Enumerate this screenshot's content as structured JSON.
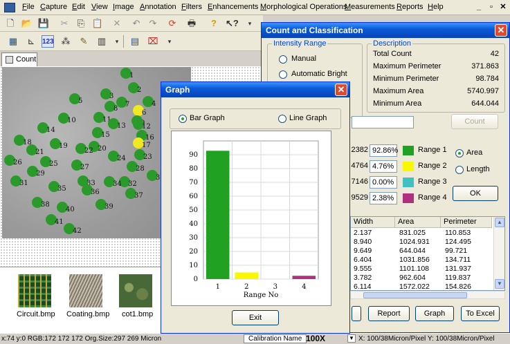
{
  "menubar": {
    "items": [
      "File",
      "Capture",
      "Edit",
      "View",
      "Image",
      "Annotation",
      "Filters",
      "Enhancements",
      "Morphological Operations",
      "Measurements",
      "Reports",
      "Help"
    ],
    "window_controls": [
      "_",
      "▫",
      "✕"
    ]
  },
  "tabs": {
    "count_label": "Count"
  },
  "thumbnails": [
    {
      "label": "Circuit.bmp"
    },
    {
      "label": "Coating.bmp"
    },
    {
      "label": "cot1.bmp"
    }
  ],
  "statusbar": {
    "info": "x:74 y:0 RGB:172 172 172 Org.Size:297 269 Micron",
    "calibration_label": "Calibration Name",
    "magnification": "100X",
    "pixel_info": "X: 100/38Micron/Pixel Y: 100/38Micron/Pixel"
  },
  "count_dialog": {
    "title": "Count and Classification",
    "intensity_range_title": "Intensity Range",
    "manual_label": "Manual",
    "automatic_label": "Automatic Bright",
    "description_title": "Description",
    "descriptions": [
      {
        "label": "Total Count",
        "value": "42"
      },
      {
        "label": "Maximum Perimeter",
        "value": "371.863"
      },
      {
        "label": "Minimum Perimeter",
        "value": "98.784"
      },
      {
        "label": "Maximum Area",
        "value": "5740.997"
      },
      {
        "label": "Minimum Area",
        "value": "644.044"
      }
    ],
    "count_button": "Count",
    "ranges": [
      {
        "value": "2382",
        "percent": "92.86%",
        "label": "Range 1",
        "color": "#21a121"
      },
      {
        "value": "4764",
        "percent": "4.76%",
        "label": "Range 2",
        "color": "#f8f800"
      },
      {
        "value": "7146",
        "percent": "0.00%",
        "label": "Range 3",
        "color": "#40c0c0"
      },
      {
        "value": "9529",
        "percent": "2.38%",
        "label": "Range 4",
        "color": "#b03080"
      }
    ],
    "area_label": "Area",
    "length_label": "Length",
    "ok_button": "OK",
    "table_headers": [
      "Width",
      "Area",
      "Perimeter"
    ],
    "table_rows": [
      [
        "2.137",
        "831.025",
        "110.853"
      ],
      [
        "8.940",
        "1024.931",
        "124.495"
      ],
      [
        "9.649",
        "644.044",
        "99.721"
      ],
      [
        "6.404",
        "1031.856",
        "134.711"
      ],
      [
        "9.555",
        "1101.108",
        "131.937"
      ],
      [
        "3.782",
        "962.604",
        "119.837"
      ],
      [
        "6.114",
        "1572.022",
        "154.826"
      ]
    ],
    "report_button": "Report",
    "graph_button": "Graph",
    "excel_button": "To Excel"
  },
  "graph_dialog": {
    "title": "Graph",
    "bar_graph_label": "Bar Graph",
    "line_graph_label": "Line Graph",
    "exit_button": "Exit"
  },
  "chart_data": {
    "type": "bar",
    "categories": [
      "1",
      "2",
      "3",
      "4"
    ],
    "values": [
      92.86,
      4.76,
      0.0,
      2.38
    ],
    "colors": [
      "#21a121",
      "#f8f800",
      "#40c0c0",
      "#b03080"
    ],
    "xlabel": "Range No",
    "ylabel": "",
    "ylim": [
      0,
      100
    ],
    "yticks": [
      0,
      10,
      20,
      30,
      40,
      50,
      60,
      70,
      80,
      90
    ],
    "grid": true
  },
  "blobs": [
    {
      "n": "1"
    },
    {
      "n": "2"
    },
    {
      "n": "3"
    },
    {
      "n": "4"
    },
    {
      "n": "5"
    },
    {
      "n": "6"
    },
    {
      "n": "7"
    },
    {
      "n": "8"
    },
    {
      "n": "9"
    },
    {
      "n": "10"
    },
    {
      "n": "11"
    },
    {
      "n": "12"
    },
    {
      "n": "13"
    },
    {
      "n": "14"
    },
    {
      "n": "15"
    },
    {
      "n": "16"
    },
    {
      "n": "17"
    },
    {
      "n": "18"
    },
    {
      "n": "19"
    },
    {
      "n": "20"
    },
    {
      "n": "21"
    },
    {
      "n": "22"
    },
    {
      "n": "23"
    },
    {
      "n": "24"
    },
    {
      "n": "25"
    },
    {
      "n": "26"
    },
    {
      "n": "27"
    },
    {
      "n": "28"
    },
    {
      "n": "29"
    },
    {
      "n": "30"
    },
    {
      "n": "31"
    },
    {
      "n": "32"
    },
    {
      "n": "33"
    },
    {
      "n": "34"
    },
    {
      "n": "35"
    },
    {
      "n": "36"
    },
    {
      "n": "37"
    },
    {
      "n": "38"
    },
    {
      "n": "39"
    },
    {
      "n": "40"
    },
    {
      "n": "41"
    },
    {
      "n": "42"
    }
  ]
}
